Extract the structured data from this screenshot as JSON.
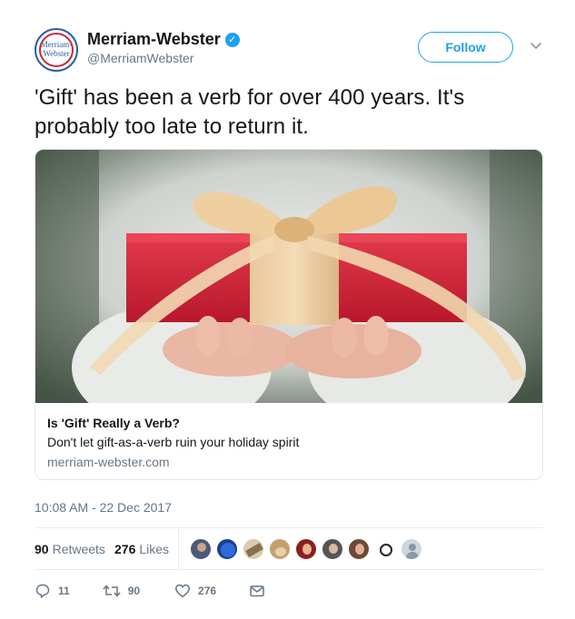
{
  "author": {
    "display_name": "Merriam-Webster",
    "handle": "@MerriamWebster",
    "avatar_text_line1": "Merriam-",
    "avatar_text_line2": "Webster",
    "verified": true
  },
  "follow_button": {
    "label": "Follow"
  },
  "tweet": {
    "text": "'Gift' has been a verb for over 400 years. It's probably too late to return it.",
    "timestamp": "10:08 AM - 22 Dec 2017"
  },
  "card": {
    "title": "Is 'Gift' Really a Verb?",
    "description": "Don't let gift-as-a-verb ruin your holiday spirit",
    "domain": "merriam-webster.com",
    "image": "red-gift-box-with-gold-ribbon"
  },
  "stats": {
    "retweets_count": "90",
    "retweets_label": "Retweets",
    "likes_count": "276",
    "likes_label": "Likes",
    "liker_avatar_count": 9
  },
  "actions": {
    "reply_count": "11",
    "retweet_count": "90",
    "like_count": "276"
  },
  "colors": {
    "accent": "#1da1f2",
    "text": "#14171a",
    "secondary": "#657786",
    "border": "#e1e8ed"
  }
}
